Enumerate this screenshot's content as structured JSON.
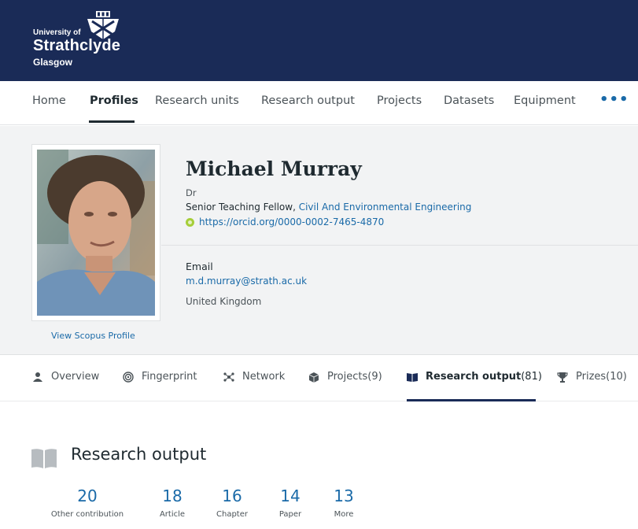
{
  "header": {
    "logo_line1": "University of",
    "logo_line2": "Strathclyde",
    "logo_line3": "Glasgow",
    "crest_icon": "crest-icon"
  },
  "nav": {
    "items": [
      {
        "label": "Home",
        "active": false
      },
      {
        "label": "Profiles",
        "active": true
      },
      {
        "label": "Research units",
        "active": false
      },
      {
        "label": "Research output",
        "active": false
      },
      {
        "label": "Projects",
        "active": false
      },
      {
        "label": "Datasets",
        "active": false
      },
      {
        "label": "Equipment",
        "active": false
      }
    ],
    "more_label": "•••"
  },
  "profile": {
    "name": "Michael Murray",
    "honorific": "Dr",
    "position": "Senior Teaching Fellow, ",
    "department": "Civil And Environmental Engineering",
    "orcid": "https://orcid.org/0000-0002-7465-4870",
    "email_label": "Email",
    "email": "m.d.murray@strath.ac.uk",
    "country": "United Kingdom",
    "scopus_link": "View Scopus Profile"
  },
  "subtabs": [
    {
      "label": "Overview",
      "count": "",
      "icon": "person-icon",
      "active": false
    },
    {
      "label": "Fingerprint",
      "count": "",
      "icon": "fingerprint-icon",
      "active": false
    },
    {
      "label": "Network",
      "count": "",
      "icon": "network-icon",
      "active": false
    },
    {
      "label": "Projects",
      "count": " (9)",
      "icon": "box-icon",
      "active": false
    },
    {
      "label": "Research output",
      "count": " (81)",
      "icon": "book-icon",
      "active": true
    },
    {
      "label": "Prizes",
      "count": " (10)",
      "icon": "trophy-icon",
      "active": false
    }
  ],
  "research_output": {
    "title": "Research output",
    "stats": [
      {
        "num": "20",
        "label": "Other contribution"
      },
      {
        "num": "18",
        "label": "Article"
      },
      {
        "num": "16",
        "label": "Chapter"
      },
      {
        "num": "14",
        "label": "Paper"
      },
      {
        "num": "13",
        "label": "More"
      }
    ]
  },
  "colors": {
    "banner": "#1a2b57",
    "link": "#1a6aa8",
    "orcid": "#a6ce39"
  }
}
